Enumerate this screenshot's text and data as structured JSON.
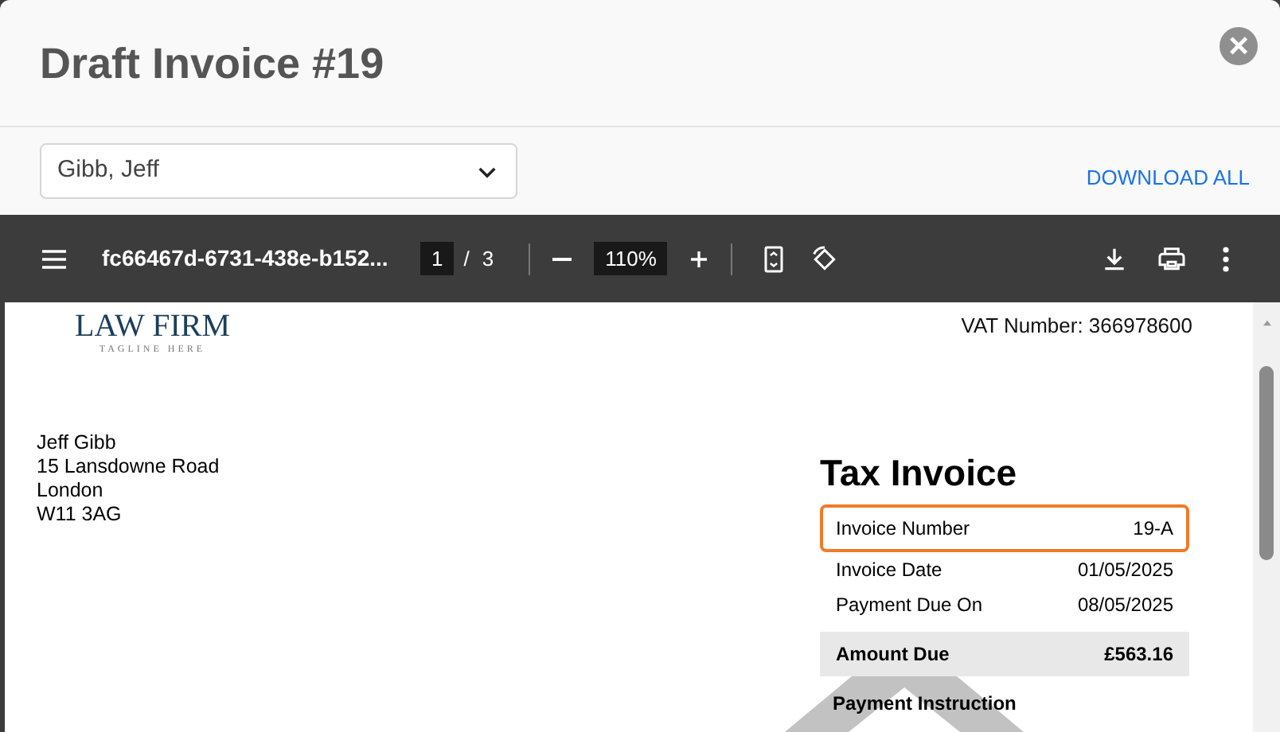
{
  "dialog": {
    "title": "Draft Invoice #19",
    "close": "×"
  },
  "recipient_select": {
    "value": "Gibb, Jeff"
  },
  "download_all": "DOWNLOAD ALL",
  "pdf_toolbar": {
    "filename": "fc66467d-6731-438e-b152...",
    "page": "1",
    "page_count": "3",
    "separator": "/",
    "zoom": "110%"
  },
  "document": {
    "logo": {
      "name": "LAW FIRM",
      "tagline": "TAGLINE HERE"
    },
    "vat": "VAT Number: 366978600",
    "address": [
      "Jeff Gibb",
      "15 Lansdowne Road",
      "London",
      "W11 3AG"
    ],
    "heading": "Tax Invoice",
    "rows": [
      {
        "kind": "plain",
        "label": "Invoice Number",
        "value": "19-A",
        "highlighted": true
      },
      {
        "kind": "plain",
        "label": "Invoice Date",
        "value": "01/05/2025",
        "highlighted": false
      },
      {
        "kind": "plain",
        "label": "Payment Due On",
        "value": "08/05/2025",
        "highlighted": false
      },
      {
        "kind": "total",
        "label": "Amount Due",
        "value": "£563.16",
        "highlighted": false
      }
    ],
    "section_heading": "Payment Instruction"
  }
}
